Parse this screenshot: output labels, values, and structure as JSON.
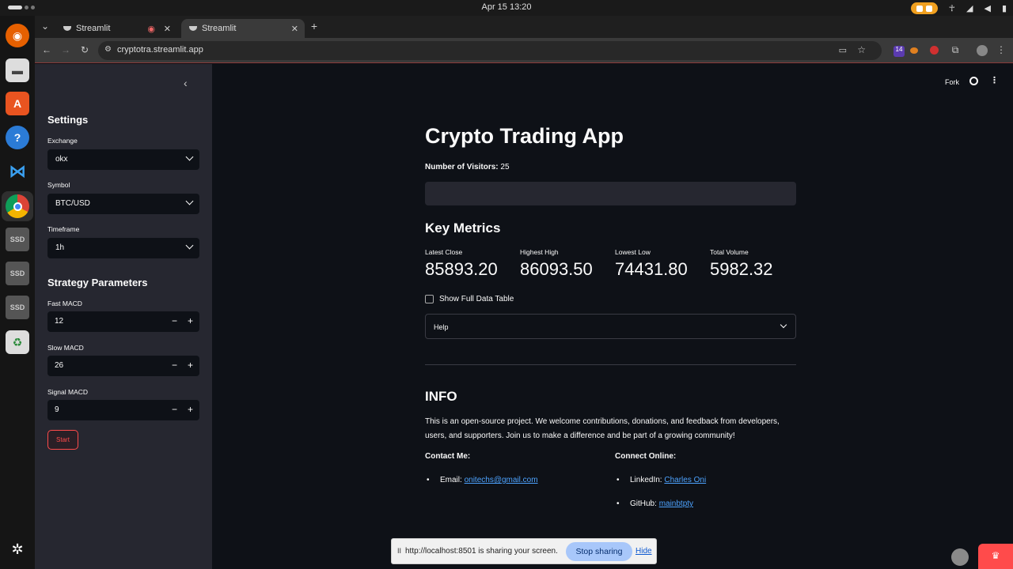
{
  "os": {
    "clock": "Apr 15  13:20",
    "tray_badge": "14"
  },
  "browser": {
    "tabs": [
      {
        "label": "Streamlit"
      },
      {
        "label": "Streamlit"
      }
    ],
    "url": "cryptotra.streamlit.app"
  },
  "sidebar": {
    "heading": "Settings",
    "exchange": {
      "label": "Exchange",
      "value": "okx"
    },
    "symbol": {
      "label": "Symbol",
      "value": "BTC/USD"
    },
    "timeframe": {
      "label": "Timeframe",
      "value": "1h"
    },
    "strategy_heading": "Strategy Parameters",
    "fast_macd": {
      "label": "Fast MACD",
      "value": "12"
    },
    "slow_macd": {
      "label": "Slow MACD",
      "value": "26"
    },
    "signal_macd": {
      "label": "Signal MACD",
      "value": "9"
    },
    "start_label": "Start",
    "minus": "−",
    "plus": "+"
  },
  "header": {
    "fork_label": "Fork",
    "menu": "⋮"
  },
  "main": {
    "title": "Crypto Trading App",
    "visitors_label": "Number of Visitors:",
    "visitors_value": "25",
    "metrics_heading": "Key Metrics",
    "metrics": [
      {
        "label": "Latest Close",
        "value": "85893.20"
      },
      {
        "label": "Highest High",
        "value": "86093.50"
      },
      {
        "label": "Lowest Low",
        "value": "74431.80"
      },
      {
        "label": "Total Volume",
        "value": "5982.32"
      }
    ],
    "show_table_label": "Show Full Data Table",
    "help_label": "Help",
    "info_heading": "INFO",
    "info_text": "This is an open-source project. We welcome contributions, donations, and feedback from developers, users, and supporters. Join us to make a difference and be part of a growing community!",
    "contact_heading": "Contact Me:",
    "connect_heading": "Connect Online:",
    "email_label": "Email:",
    "email_value": "onitechs@gmail.com",
    "linkedin_label": "LinkedIn:",
    "linkedin_value": "Charles Oni",
    "github_label": "GitHub:",
    "github_value": "mainbtpty"
  },
  "share_bar": {
    "pause": "II",
    "text": "http://localhost:8501 is sharing your screen.",
    "stop_label": "Stop sharing",
    "hide_label": "Hide"
  },
  "colors": {
    "accent": "#ff4b4b",
    "link": "#4da3ff",
    "sidebar_bg": "#262730",
    "main_bg": "#0e1117"
  }
}
